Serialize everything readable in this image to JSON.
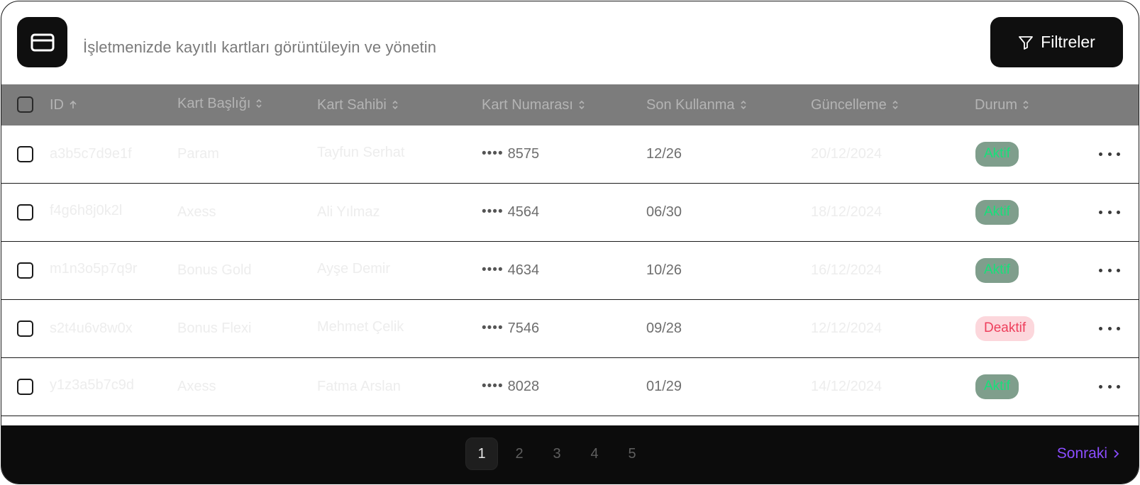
{
  "header": {
    "subtitle": "İşletmenizde kayıtlı kartları görüntüleyin ve yönetin",
    "filter_label": "Filtreler"
  },
  "table": {
    "columns": [
      "ID",
      "Kart Başlığı",
      "Kart Sahibi",
      "Kart Numarası",
      "Son Kullanma",
      "Güncelleme",
      "Durum"
    ],
    "rows": [
      {
        "id": "a3b5c7d9e1f",
        "title": "Param",
        "owner": "Tayfun Serhat",
        "dots": "••••",
        "last4": "8575",
        "expiry": "12/26",
        "updated": "20/12/2024",
        "status": "Aktif"
      },
      {
        "id": "f4g6h8j0k2l",
        "title": "Axess",
        "owner": "Ali Yılmaz",
        "dots": "••••",
        "last4": "4564",
        "expiry": "06/30",
        "updated": "18/12/2024",
        "status": "Aktif"
      },
      {
        "id": "m1n3o5p7q9r",
        "title": "Bonus Gold",
        "owner": "Ayşe Demir",
        "dots": "••••",
        "last4": "4634",
        "expiry": "10/26",
        "updated": "16/12/2024",
        "status": "Aktif"
      },
      {
        "id": "s2t4u6v8w0x",
        "title": "Bonus Flexi",
        "owner": "Mehmet Çelik",
        "dots": "••••",
        "last4": "7546",
        "expiry": "09/28",
        "updated": "12/12/2024",
        "status": "Deaktif"
      },
      {
        "id": "y1z3a5b7c9d",
        "title": "Axess",
        "owner": "Fatma Arslan",
        "dots": "••••",
        "last4": "8028",
        "expiry": "01/29",
        "updated": "14/12/2024",
        "status": "Aktif"
      }
    ]
  },
  "pagination": {
    "pages": [
      "1",
      "2",
      "3",
      "4",
      "5"
    ],
    "current": "1",
    "next_label": "Sonraki"
  },
  "colors": {
    "active_badge_bg": "#7f9e8c",
    "active_badge_text": "#17e07a",
    "inactive_badge_bg": "#fcd7dc",
    "inactive_badge_text": "#ee3f5c",
    "accent": "#8b4dff"
  },
  "icons": {
    "card": "credit-card-icon",
    "filter": "filter-icon",
    "sort": "sort-icon",
    "more": "more-horizontal-icon",
    "next": "chevron-right-icon"
  }
}
